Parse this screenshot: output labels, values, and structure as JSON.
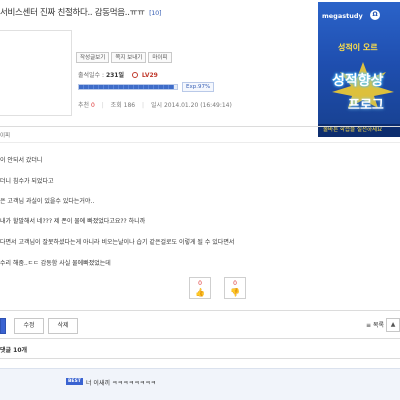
{
  "post": {
    "title": "서비스센터 진짜 친절하다.. 감동먹음..ㅠㅠ",
    "comment_count_badge": "[10]"
  },
  "profile": {
    "buttons": [
      "작성글보기",
      "쪽지 보내기",
      "마이피"
    ],
    "attendance_label": "출석일수 :",
    "attendance_value": "231일",
    "level": "LV29",
    "exp_label": "Exp.97%",
    "exp_fraction": 0.97
  },
  "meta": {
    "rec_label": "추천",
    "rec_value": "0",
    "views_label": "조회",
    "views_value": "186",
    "date_label": "일시",
    "date_value": "2014.01.20 (16:49:14)"
  },
  "ad": {
    "brand": "megastudy",
    "logo": "Ω",
    "ribbon": "성적이 오르",
    "headline1": "성적향상",
    "headline2": "프로그",
    "bottom": "올바른 학습을 실천하세요"
  },
  "author_tag": "이피",
  "body_lines": [
    "이 안되서 갔더니",
    "더니 침수가 되었다고",
    "은 고객님 과실이 있을수 있다는거야..",
    "내가 할말해서 네??? 제 폰이 물에 빠졌었다고요?? 하니까",
    "다면서 고객님이 잘못하셨다는게 아니라 비오는날이나 습기 같은걸로도 이렇게 될 수 있다면서",
    "수리 해줌..ㄷㄷ 감동함 사실 물에빠졌었는데"
  ],
  "votes": {
    "up_count": "0",
    "down_count": "0"
  },
  "actions": {
    "edit": "수정",
    "delete": "삭제",
    "list": "목록",
    "list_icon": "≡",
    "up": "▲"
  },
  "comments": {
    "label": "댓글",
    "count": "10개",
    "best_badge": "BEST",
    "best_text": "너 이새끼 ㅋㅋㅋㅋㅋㅋㅋㅋ"
  },
  "colors": {
    "accent": "#3a63d1",
    "rec": "#dd3333"
  }
}
